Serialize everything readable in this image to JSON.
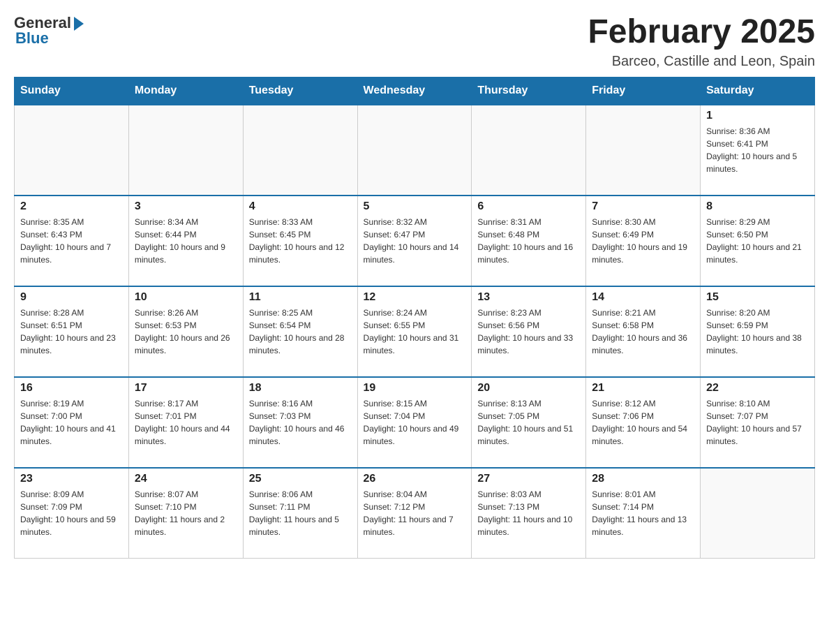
{
  "logo": {
    "general": "General",
    "blue": "Blue"
  },
  "title": "February 2025",
  "location": "Barceo, Castille and Leon, Spain",
  "days_of_week": [
    "Sunday",
    "Monday",
    "Tuesday",
    "Wednesday",
    "Thursday",
    "Friday",
    "Saturday"
  ],
  "weeks": [
    [
      {
        "day": "",
        "info": ""
      },
      {
        "day": "",
        "info": ""
      },
      {
        "day": "",
        "info": ""
      },
      {
        "day": "",
        "info": ""
      },
      {
        "day": "",
        "info": ""
      },
      {
        "day": "",
        "info": ""
      },
      {
        "day": "1",
        "info": "Sunrise: 8:36 AM\nSunset: 6:41 PM\nDaylight: 10 hours and 5 minutes."
      }
    ],
    [
      {
        "day": "2",
        "info": "Sunrise: 8:35 AM\nSunset: 6:43 PM\nDaylight: 10 hours and 7 minutes."
      },
      {
        "day": "3",
        "info": "Sunrise: 8:34 AM\nSunset: 6:44 PM\nDaylight: 10 hours and 9 minutes."
      },
      {
        "day": "4",
        "info": "Sunrise: 8:33 AM\nSunset: 6:45 PM\nDaylight: 10 hours and 12 minutes."
      },
      {
        "day": "5",
        "info": "Sunrise: 8:32 AM\nSunset: 6:47 PM\nDaylight: 10 hours and 14 minutes."
      },
      {
        "day": "6",
        "info": "Sunrise: 8:31 AM\nSunset: 6:48 PM\nDaylight: 10 hours and 16 minutes."
      },
      {
        "day": "7",
        "info": "Sunrise: 8:30 AM\nSunset: 6:49 PM\nDaylight: 10 hours and 19 minutes."
      },
      {
        "day": "8",
        "info": "Sunrise: 8:29 AM\nSunset: 6:50 PM\nDaylight: 10 hours and 21 minutes."
      }
    ],
    [
      {
        "day": "9",
        "info": "Sunrise: 8:28 AM\nSunset: 6:51 PM\nDaylight: 10 hours and 23 minutes."
      },
      {
        "day": "10",
        "info": "Sunrise: 8:26 AM\nSunset: 6:53 PM\nDaylight: 10 hours and 26 minutes."
      },
      {
        "day": "11",
        "info": "Sunrise: 8:25 AM\nSunset: 6:54 PM\nDaylight: 10 hours and 28 minutes."
      },
      {
        "day": "12",
        "info": "Sunrise: 8:24 AM\nSunset: 6:55 PM\nDaylight: 10 hours and 31 minutes."
      },
      {
        "day": "13",
        "info": "Sunrise: 8:23 AM\nSunset: 6:56 PM\nDaylight: 10 hours and 33 minutes."
      },
      {
        "day": "14",
        "info": "Sunrise: 8:21 AM\nSunset: 6:58 PM\nDaylight: 10 hours and 36 minutes."
      },
      {
        "day": "15",
        "info": "Sunrise: 8:20 AM\nSunset: 6:59 PM\nDaylight: 10 hours and 38 minutes."
      }
    ],
    [
      {
        "day": "16",
        "info": "Sunrise: 8:19 AM\nSunset: 7:00 PM\nDaylight: 10 hours and 41 minutes."
      },
      {
        "day": "17",
        "info": "Sunrise: 8:17 AM\nSunset: 7:01 PM\nDaylight: 10 hours and 44 minutes."
      },
      {
        "day": "18",
        "info": "Sunrise: 8:16 AM\nSunset: 7:03 PM\nDaylight: 10 hours and 46 minutes."
      },
      {
        "day": "19",
        "info": "Sunrise: 8:15 AM\nSunset: 7:04 PM\nDaylight: 10 hours and 49 minutes."
      },
      {
        "day": "20",
        "info": "Sunrise: 8:13 AM\nSunset: 7:05 PM\nDaylight: 10 hours and 51 minutes."
      },
      {
        "day": "21",
        "info": "Sunrise: 8:12 AM\nSunset: 7:06 PM\nDaylight: 10 hours and 54 minutes."
      },
      {
        "day": "22",
        "info": "Sunrise: 8:10 AM\nSunset: 7:07 PM\nDaylight: 10 hours and 57 minutes."
      }
    ],
    [
      {
        "day": "23",
        "info": "Sunrise: 8:09 AM\nSunset: 7:09 PM\nDaylight: 10 hours and 59 minutes."
      },
      {
        "day": "24",
        "info": "Sunrise: 8:07 AM\nSunset: 7:10 PM\nDaylight: 11 hours and 2 minutes."
      },
      {
        "day": "25",
        "info": "Sunrise: 8:06 AM\nSunset: 7:11 PM\nDaylight: 11 hours and 5 minutes."
      },
      {
        "day": "26",
        "info": "Sunrise: 8:04 AM\nSunset: 7:12 PM\nDaylight: 11 hours and 7 minutes."
      },
      {
        "day": "27",
        "info": "Sunrise: 8:03 AM\nSunset: 7:13 PM\nDaylight: 11 hours and 10 minutes."
      },
      {
        "day": "28",
        "info": "Sunrise: 8:01 AM\nSunset: 7:14 PM\nDaylight: 11 hours and 13 minutes."
      },
      {
        "day": "",
        "info": ""
      }
    ]
  ]
}
